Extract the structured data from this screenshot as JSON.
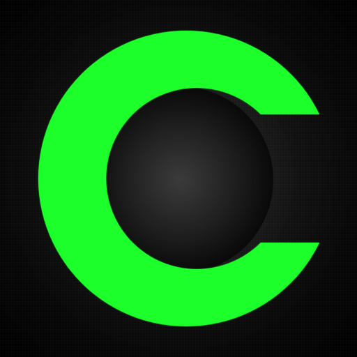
{
  "icon": {
    "name": "letter-c-logo-icon",
    "accent_color": "#1cff2a",
    "background_color": "#111111"
  }
}
